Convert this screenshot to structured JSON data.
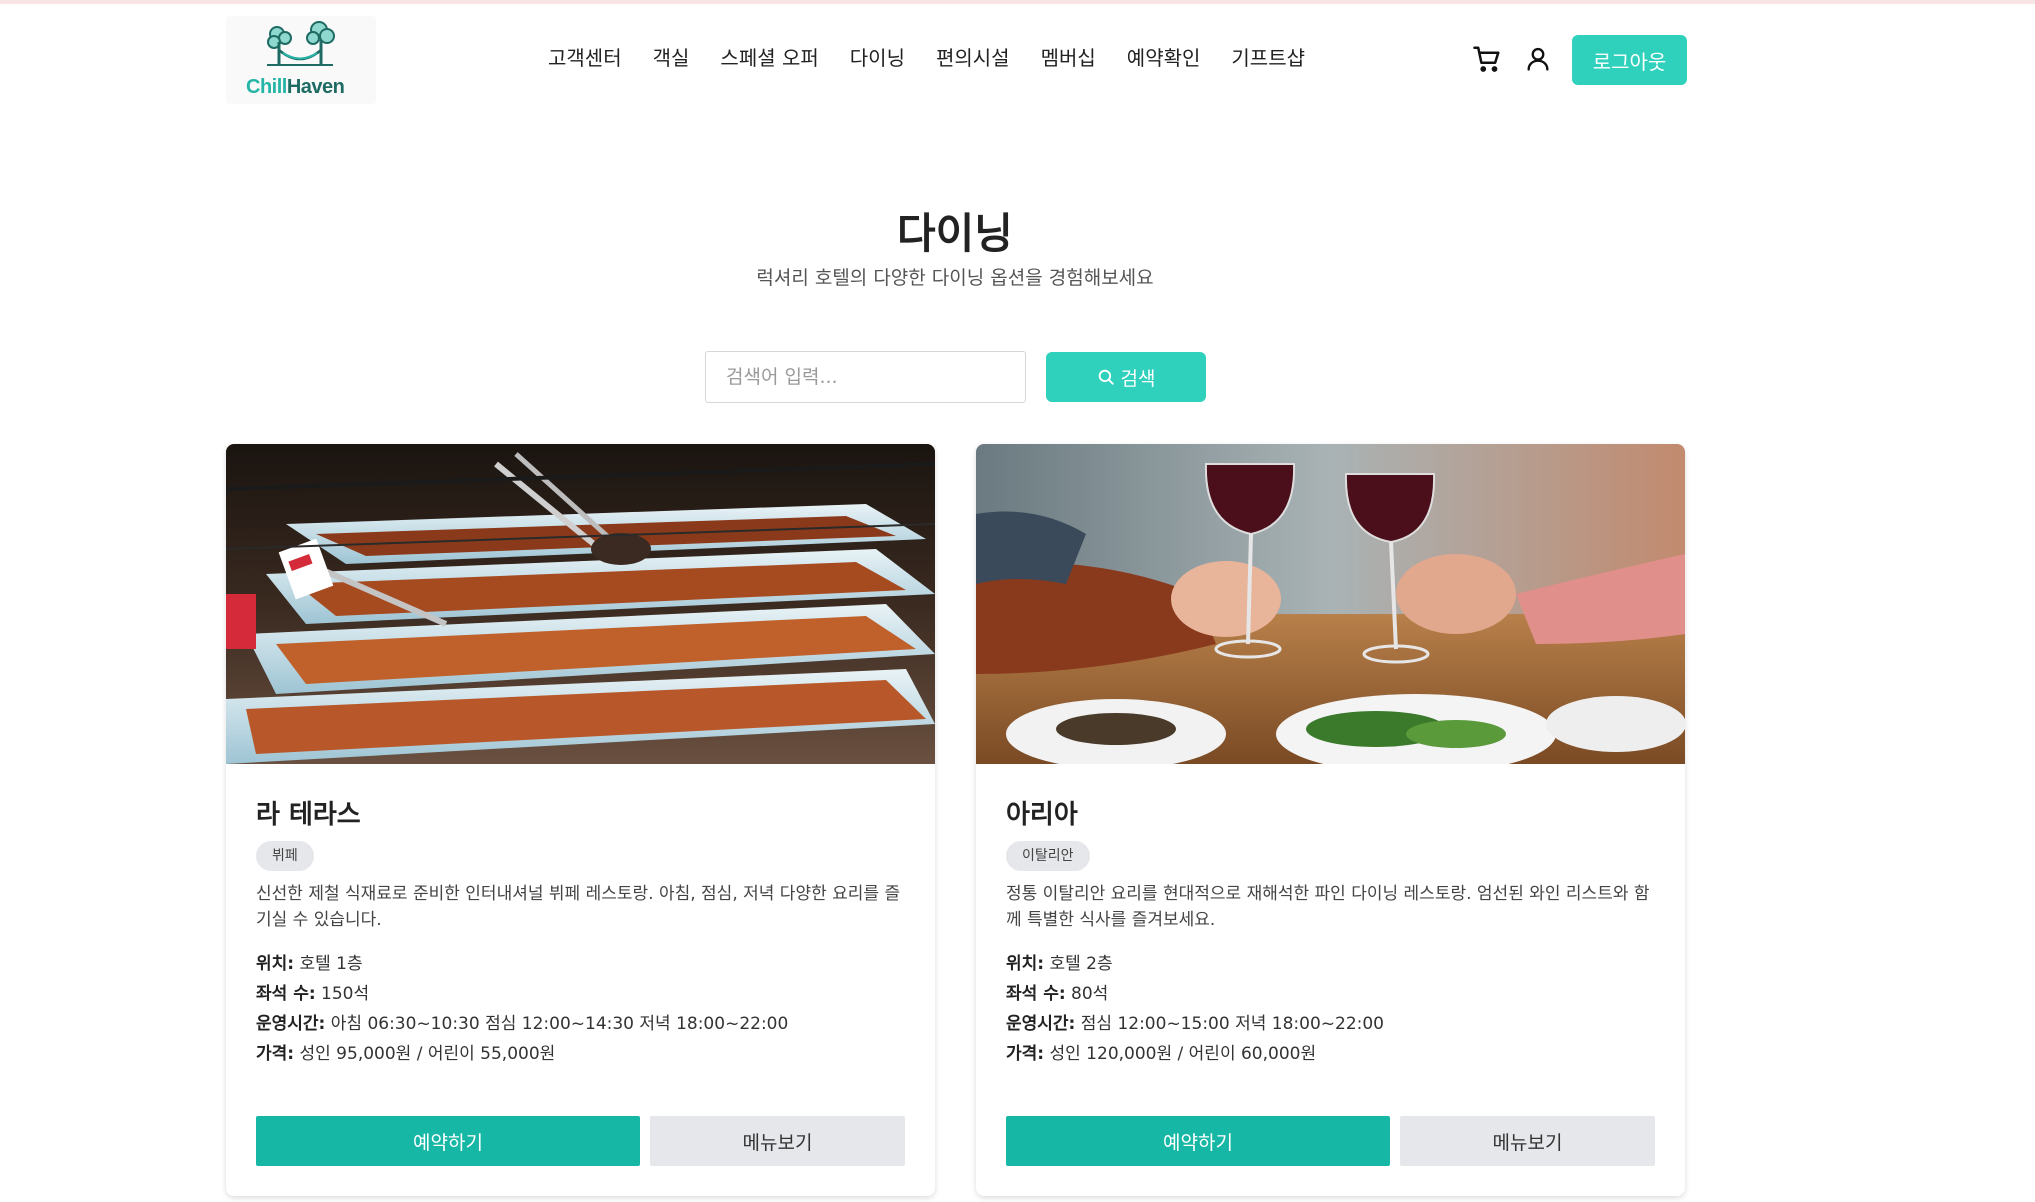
{
  "brand": {
    "name_part1": "Chill",
    "name_part2": "Haven",
    "color_primary": "#25b5a6",
    "color_dark": "#1e6b64"
  },
  "nav": {
    "items": [
      {
        "label": "고객센터"
      },
      {
        "label": "객실"
      },
      {
        "label": "스페셜 오퍼"
      },
      {
        "label": "다이닝"
      },
      {
        "label": "편의시설"
      },
      {
        "label": "멤버십"
      },
      {
        "label": "예약확인"
      },
      {
        "label": "기프트샵"
      }
    ],
    "cart_icon": "cart-icon",
    "user_icon": "user-icon",
    "logout_label": "로그아웃"
  },
  "page": {
    "title": "다이닝",
    "subtitle": "럭셔리 호텔의 다양한 다이닝 옵션을 경험해보세요"
  },
  "search": {
    "placeholder": "검색어 입력...",
    "value": "",
    "button_label": "검색",
    "icon": "search-icon"
  },
  "restaurants": [
    {
      "name": "라 테라스",
      "tag": "뷔페",
      "description": "신선한 제철 식재료로 준비한 인터내셔널 뷔페 레스토랑. 아침, 점심, 저녁 다양한 요리를 즐기실 수 있습니다.",
      "location_label": "위치:",
      "location": "호텔 1층",
      "seats_label": "좌석 수:",
      "seats": "150석",
      "hours_label": "운영시간:",
      "hours": "아침 06:30~10:30 점심 12:00~14:30 저녁 18:00~22:00",
      "price_label": "가격:",
      "price": "성인 95,000원 / 어린이 55,000원",
      "reserve_label": "예약하기",
      "menu_label": "메뉴보기"
    },
    {
      "name": "아리아",
      "tag": "이탈리안",
      "description": "정통 이탈리안 요리를 현대적으로 재해석한 파인 다이닝 레스토랑. 엄선된 와인 리스트와 함께 특별한 식사를 즐겨보세요.",
      "location_label": "위치:",
      "location": "호텔 2층",
      "seats_label": "좌석 수:",
      "seats": "80석",
      "hours_label": "운영시간:",
      "hours": "점심 12:00~15:00 저녁 18:00~22:00",
      "price_label": "가격:",
      "price": "성인 120,000원 / 어린이 60,000원",
      "reserve_label": "예약하기",
      "menu_label": "메뉴보기"
    }
  ],
  "colors": {
    "accent": "#2fd1bd",
    "button_primary": "#17b7a6",
    "button_secondary": "#e5e7eb"
  }
}
